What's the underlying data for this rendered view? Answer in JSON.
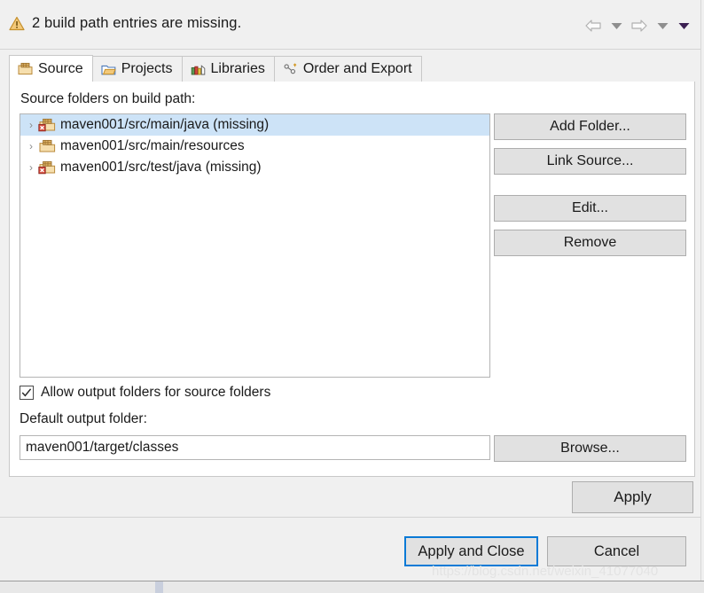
{
  "header": {
    "warning_text": "2 build path entries are missing.",
    "warning_icon": "warning-triangle-icon",
    "nav": {
      "back_icon": "arrow-left-icon",
      "back_menu_icon": "caret-down-icon",
      "forward_icon": "arrow-right-icon",
      "forward_menu_icon": "caret-down-icon",
      "overflow_menu_icon": "caret-down-filled-icon"
    }
  },
  "tabs": [
    {
      "label": "Source",
      "icon": "source-folder-icon",
      "active": true
    },
    {
      "label": "Projects",
      "icon": "project-folder-icon",
      "active": false
    },
    {
      "label": "Libraries",
      "icon": "library-books-icon",
      "active": false
    },
    {
      "label": "Order and Export",
      "icon": "order-export-icon",
      "active": false
    }
  ],
  "main": {
    "source_label": "Source folders on build path:",
    "tree": [
      {
        "label": "maven001/src/main/java (missing)",
        "missing": true,
        "selected": true,
        "twisty": "›"
      },
      {
        "label": "maven001/src/main/resources",
        "missing": false,
        "selected": false,
        "twisty": "›"
      },
      {
        "label": "maven001/src/test/java (missing)",
        "missing": true,
        "selected": false,
        "twisty": "›"
      }
    ],
    "side_buttons": {
      "add_folder": "Add Folder...",
      "link_source": "Link Source...",
      "edit": "Edit...",
      "remove": "Remove"
    },
    "allow_output": {
      "label": "Allow output folders for source folders",
      "checked": true,
      "check_glyph": "✓"
    },
    "default_output_label": "Default output folder:",
    "output_value": "maven001/target/classes",
    "browse": "Browse..."
  },
  "footer": {
    "apply": "Apply",
    "apply_and_close": "Apply and Close",
    "cancel": "Cancel"
  },
  "watermark": "https://blog.csdn.net/weixin_41077040",
  "colors": {
    "selection": "#cde3f7",
    "focus_border": "#0a7ad6",
    "warning": "#e8a33d",
    "error_badge": "#d64a3a",
    "button_face": "#e1e1e1"
  }
}
